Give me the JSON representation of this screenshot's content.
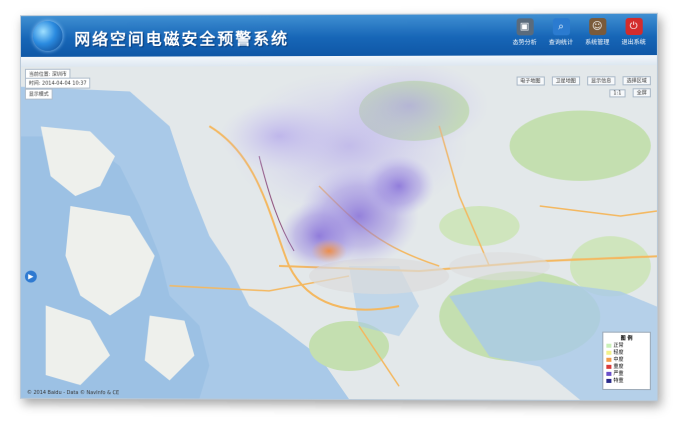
{
  "app": {
    "title": "网络空间电磁安全预警系统"
  },
  "toolbar": {
    "buttons": [
      {
        "label": "态势分析",
        "icon": "monitor-icon",
        "color": "#5a6b7c"
      },
      {
        "label": "查询统计",
        "icon": "search-icon",
        "color": "#2b7bd0"
      },
      {
        "label": "系统管理",
        "icon": "user-icon",
        "color": "#7a5a3a"
      },
      {
        "label": "退出系统",
        "icon": "power-icon",
        "color": "#d32c2c"
      }
    ]
  },
  "map_controls": {
    "region_label": "当前位置: 深圳市",
    "time_label": "时间: 2014-04-04 10:37",
    "filter_label": "显示模式",
    "right_buttons": [
      "电子地图",
      "卫星地图",
      "显示信息",
      "选择区域"
    ],
    "zoom_labels": [
      "1:1",
      "全屏"
    ]
  },
  "legend": {
    "title": "图 例",
    "items": [
      {
        "label": "正常",
        "color": "#c9f0b8"
      },
      {
        "label": "轻度",
        "color": "#f2f28a"
      },
      {
        "label": "中度",
        "color": "#f29c4a"
      },
      {
        "label": "重度",
        "color": "#d93a3a"
      },
      {
        "label": "严重",
        "color": "#6a4fc9"
      },
      {
        "label": "特重",
        "color": "#2b2b8a"
      }
    ]
  },
  "footer": {
    "copyright": "© 2014 Baidu - Data © NavInfo & CE"
  }
}
